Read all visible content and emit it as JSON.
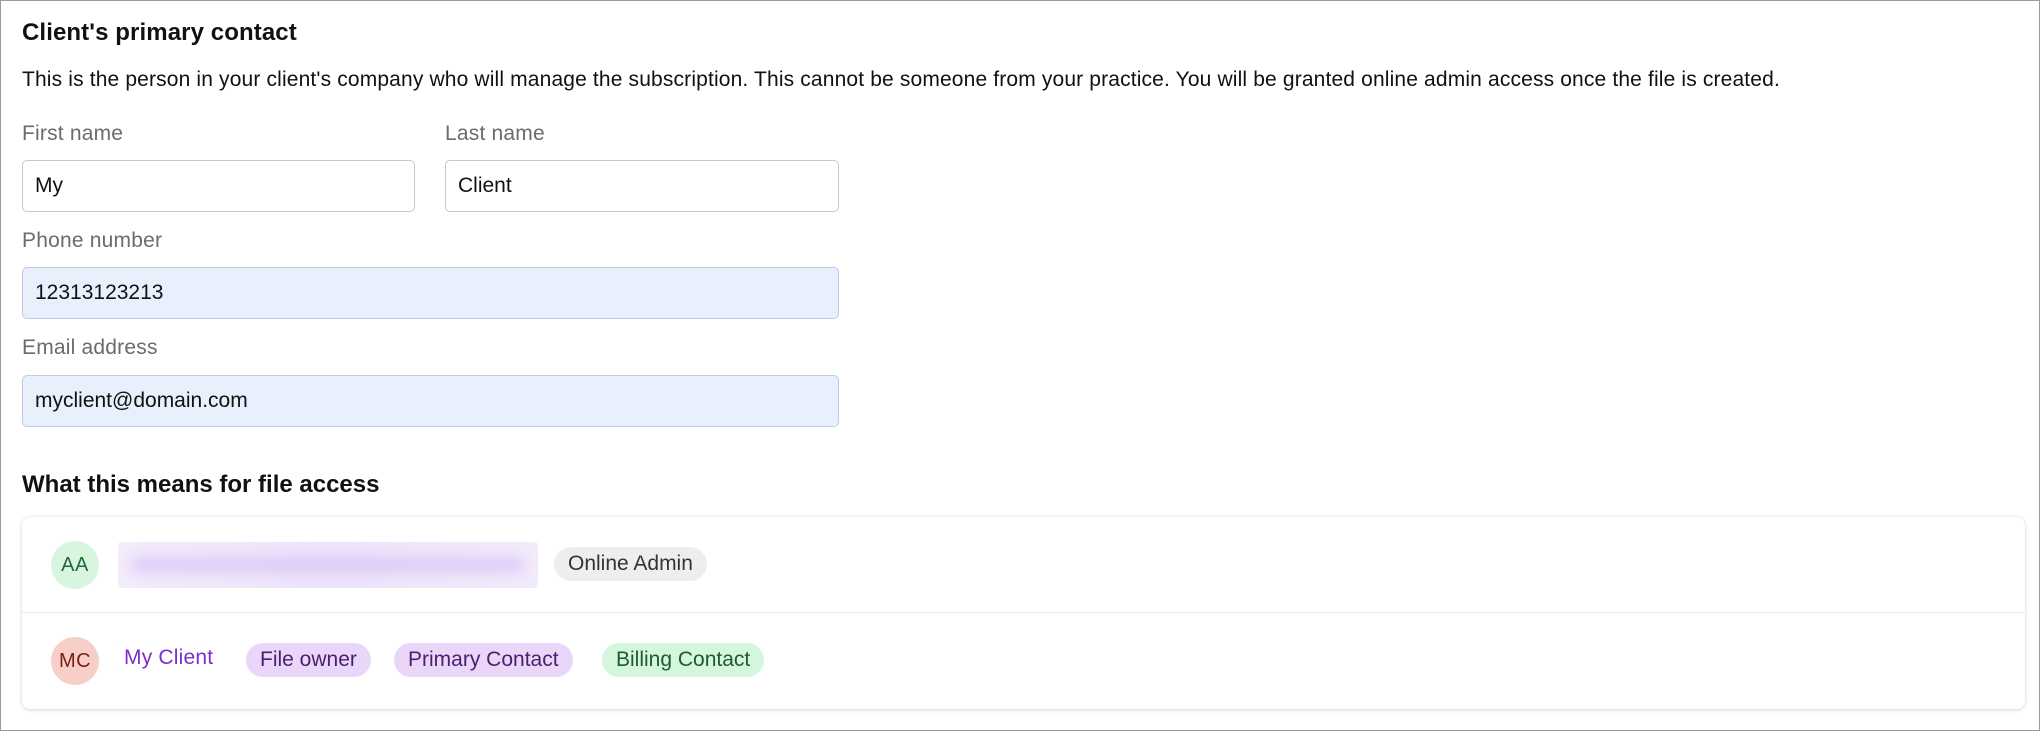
{
  "primary_contact": {
    "title": "Client's primary contact",
    "description": "This is the person in your client's company who will manage the subscription. This cannot be someone from your practice. You will be granted online admin access once the file is created.",
    "first_name": {
      "label": "First name",
      "value": "My"
    },
    "last_name": {
      "label": "Last name",
      "value": "Client"
    },
    "phone": {
      "label": "Phone number",
      "value": "12313123213"
    },
    "email": {
      "label": "Email address",
      "value": "myclient@domain.com"
    }
  },
  "file_access": {
    "title": "What this means for file access",
    "users": [
      {
        "initials": "AA",
        "name_redacted": true,
        "badges": [
          "Online Admin"
        ]
      },
      {
        "initials": "MC",
        "name": "My Client",
        "badges": [
          "File owner",
          "Primary Contact",
          "Billing Contact"
        ]
      }
    ]
  },
  "colors": {
    "autofill_bg": "#e8effd",
    "link_purple": "#7b2fc9",
    "badge_purple": "#ead6f9",
    "badge_green": "#d4f6dd",
    "badge_grey": "#eeeeee",
    "avatar_green": "#d8f6df",
    "avatar_red": "#f7cfc8"
  }
}
